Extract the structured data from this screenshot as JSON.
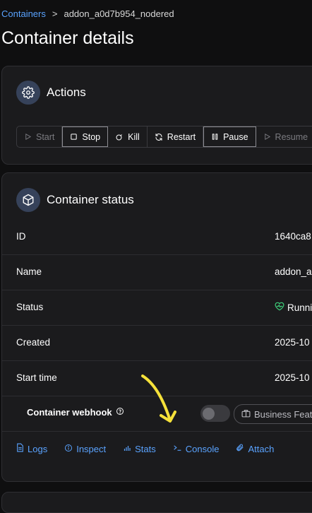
{
  "breadcrumb": {
    "parent": "Containers",
    "separator": ">",
    "current": "addon_a0d7b954_nodered"
  },
  "page_title": "Container details",
  "actions": {
    "title": "Actions",
    "buttons": [
      {
        "label": "Start",
        "icon": "play-icon",
        "state": "disabled"
      },
      {
        "label": "Stop",
        "icon": "stop-icon",
        "state": "active"
      },
      {
        "label": "Kill",
        "icon": "bomb-icon",
        "state": "enabled"
      },
      {
        "label": "Restart",
        "icon": "refresh-icon",
        "state": "enabled"
      },
      {
        "label": "Pause",
        "icon": "pause-icon",
        "state": "active"
      },
      {
        "label": "Resume",
        "icon": "play-icon",
        "state": "disabled"
      }
    ]
  },
  "status": {
    "title": "Container status",
    "rows": [
      {
        "key": "ID",
        "value": "1640ca8"
      },
      {
        "key": "Name",
        "value": "addon_a"
      },
      {
        "key": "Status",
        "value": "Runni"
      },
      {
        "key": "Created",
        "value": "2025-10"
      },
      {
        "key": "Start time",
        "value": "2025-10"
      }
    ],
    "webhook": {
      "label": "Container webhook",
      "badge": "Business Feat",
      "enabled": false
    },
    "links": [
      {
        "label": "Logs",
        "icon": "file-icon"
      },
      {
        "label": "Inspect",
        "icon": "info-icon"
      },
      {
        "label": "Stats",
        "icon": "chart-icon"
      },
      {
        "label": "Console",
        "icon": "terminal-icon"
      },
      {
        "label": "Attach",
        "icon": "paperclip-icon"
      }
    ]
  },
  "colors": {
    "link": "#5aa3ff",
    "healthy": "#3ecf7a",
    "annotation": "#f5e13a"
  }
}
